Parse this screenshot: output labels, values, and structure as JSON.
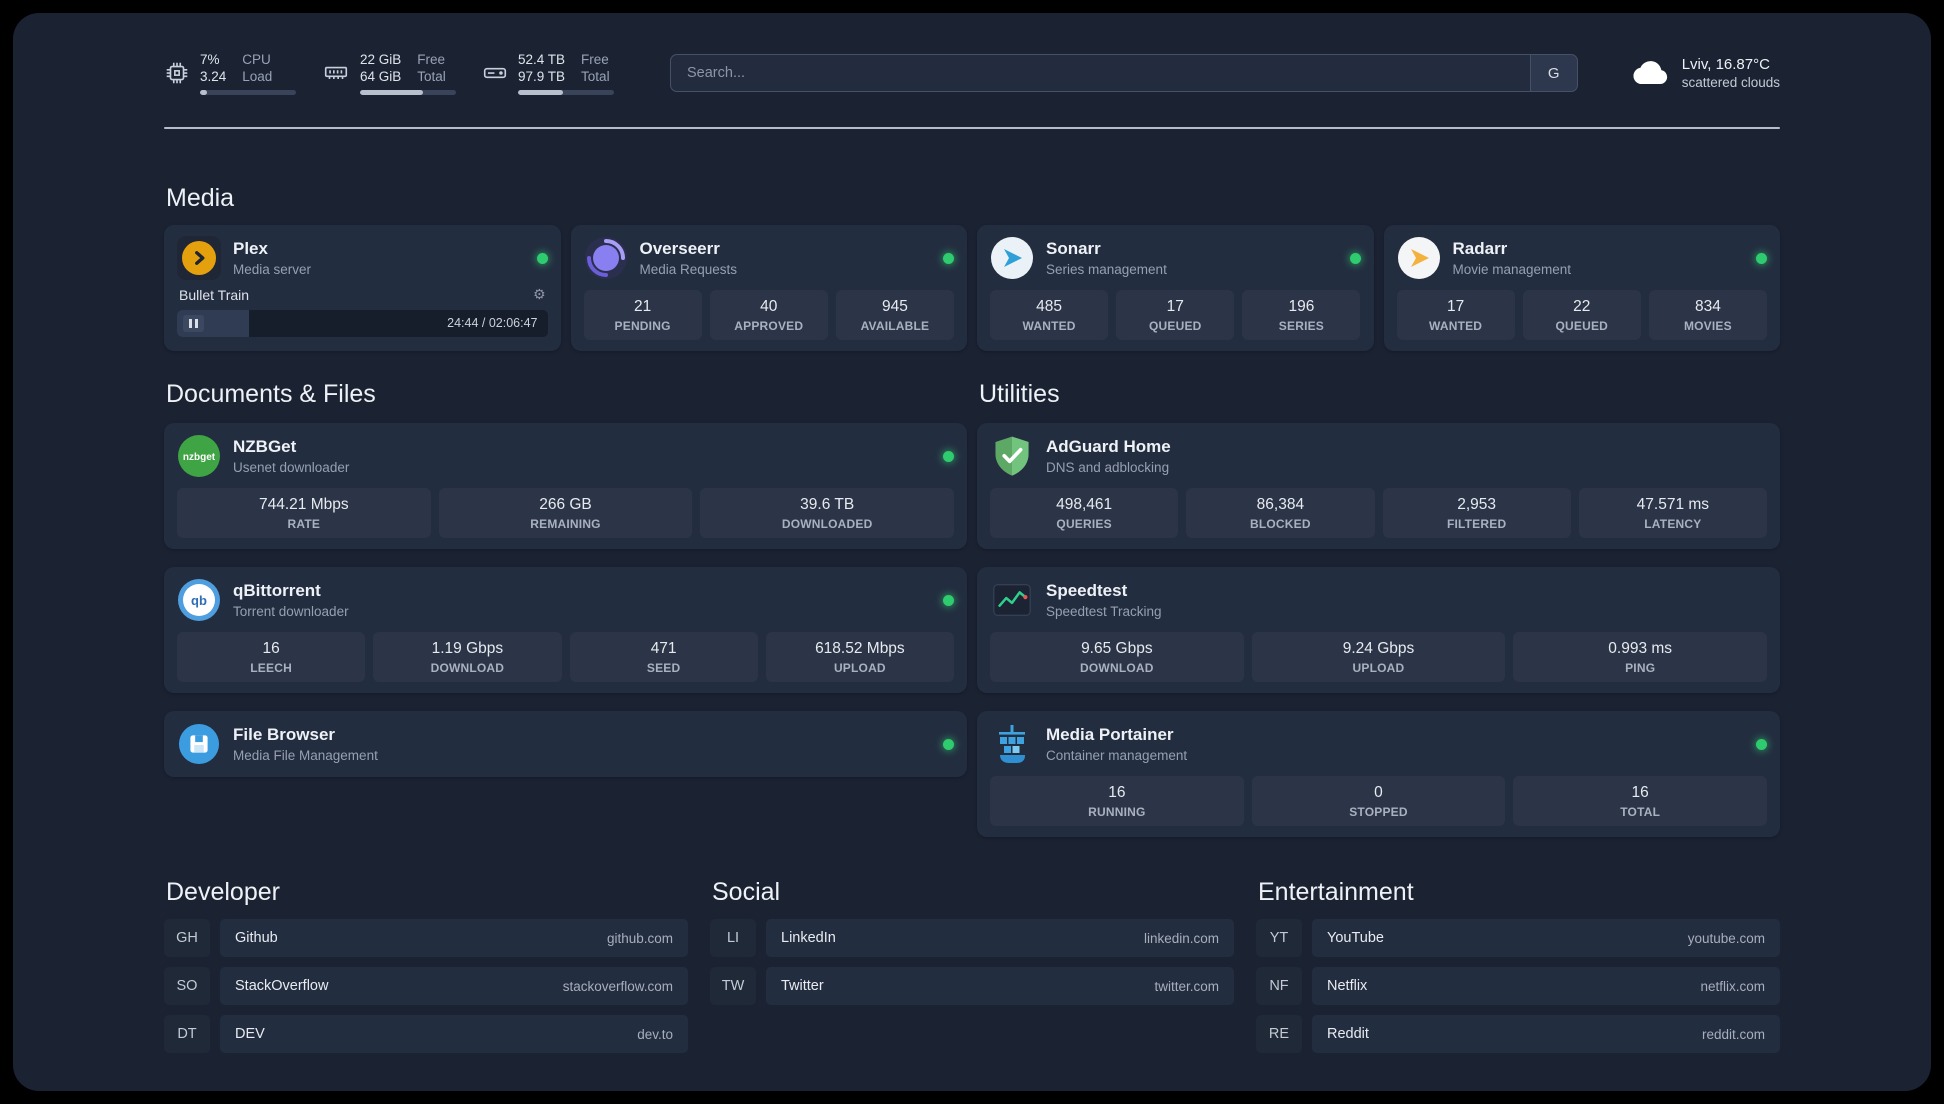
{
  "icons": {
    "gear": "⚙"
  },
  "topbar": {
    "cpu": {
      "value1": "7%",
      "value2": "3.24",
      "label1": "CPU",
      "label2": "Load",
      "progress_pct": 7
    },
    "memory": {
      "value1": "22 GiB",
      "value2": "64 GiB",
      "label1": "Free",
      "label2": "Total",
      "progress_pct": 66
    },
    "disk": {
      "value1": "52.4 TB",
      "value2": "97.9 TB",
      "label1": "Free",
      "label2": "Total",
      "progress_pct": 47
    },
    "search": {
      "placeholder": "Search...",
      "button_label": "G"
    },
    "weather": {
      "location": "Lviv, 16.87°C",
      "condition": "scattered clouds"
    }
  },
  "media": {
    "title": "Media",
    "plex": {
      "name": "Plex",
      "subtitle": "Media server",
      "now_playing": "Bullet Train",
      "time": "24:44 / 02:06:47",
      "progress_pct": 19.5
    },
    "overseerr": {
      "name": "Overseerr",
      "subtitle": "Media Requests",
      "stats": [
        {
          "value": "21",
          "label": "PENDING"
        },
        {
          "value": "40",
          "label": "APPROVED"
        },
        {
          "value": "945",
          "label": "AVAILABLE"
        }
      ]
    },
    "sonarr": {
      "name": "Sonarr",
      "subtitle": "Series management",
      "stats": [
        {
          "value": "485",
          "label": "WANTED"
        },
        {
          "value": "17",
          "label": "QUEUED"
        },
        {
          "value": "196",
          "label": "SERIES"
        }
      ]
    },
    "radarr": {
      "name": "Radarr",
      "subtitle": "Movie management",
      "stats": [
        {
          "value": "17",
          "label": "WANTED"
        },
        {
          "value": "22",
          "label": "QUEUED"
        },
        {
          "value": "834",
          "label": "MOVIES"
        }
      ]
    }
  },
  "documents": {
    "title": "Documents & Files",
    "nzbget": {
      "name": "NZBGet",
      "subtitle": "Usenet downloader",
      "icon_text": "nzbget",
      "stats": [
        {
          "value": "744.21 Mbps",
          "label": "RATE"
        },
        {
          "value": "266 GB",
          "label": "REMAINING"
        },
        {
          "value": "39.6 TB",
          "label": "DOWNLOADED"
        }
      ]
    },
    "qbittorrent": {
      "name": "qBittorrent",
      "subtitle": "Torrent downloader",
      "icon_text": "qb",
      "stats": [
        {
          "value": "16",
          "label": "LEECH"
        },
        {
          "value": "1.19 Gbps",
          "label": "DOWNLOAD"
        },
        {
          "value": "471",
          "label": "SEED"
        },
        {
          "value": "618.52 Mbps",
          "label": "UPLOAD"
        }
      ]
    },
    "filebrowser": {
      "name": "File Browser",
      "subtitle": "Media File Management"
    }
  },
  "utilities": {
    "title": "Utilities",
    "adguard": {
      "name": "AdGuard Home",
      "subtitle": "DNS and adblocking",
      "stats": [
        {
          "value": "498,461",
          "label": "QUERIES"
        },
        {
          "value": "86,384",
          "label": "BLOCKED"
        },
        {
          "value": "2,953",
          "label": "FILTERED"
        },
        {
          "value": "47.571 ms",
          "label": "LATENCY"
        }
      ]
    },
    "speedtest": {
      "name": "Speedtest",
      "subtitle": "Speedtest Tracking",
      "stats": [
        {
          "value": "9.65 Gbps",
          "label": "DOWNLOAD"
        },
        {
          "value": "9.24 Gbps",
          "label": "UPLOAD"
        },
        {
          "value": "0.993 ms",
          "label": "PING"
        }
      ]
    },
    "portainer": {
      "name": "Media Portainer",
      "subtitle": "Container management",
      "stats": [
        {
          "value": "16",
          "label": "RUNNING"
        },
        {
          "value": "0",
          "label": "STOPPED"
        },
        {
          "value": "16",
          "label": "TOTAL"
        }
      ]
    }
  },
  "bookmarks": {
    "developer": {
      "title": "Developer",
      "items": [
        {
          "abbr": "GH",
          "name": "Github",
          "url": "github.com"
        },
        {
          "abbr": "SO",
          "name": "StackOverflow",
          "url": "stackoverflow.com"
        },
        {
          "abbr": "DT",
          "name": "DEV",
          "url": "dev.to"
        }
      ]
    },
    "social": {
      "title": "Social",
      "items": [
        {
          "abbr": "LI",
          "name": "LinkedIn",
          "url": "linkedin.com"
        },
        {
          "abbr": "TW",
          "name": "Twitter",
          "url": "twitter.com"
        }
      ]
    },
    "entertainment": {
      "title": "Entertainment",
      "items": [
        {
          "abbr": "YT",
          "name": "YouTube",
          "url": "youtube.com"
        },
        {
          "abbr": "NF",
          "name": "Netflix",
          "url": "netflix.com"
        },
        {
          "abbr": "RE",
          "name": "Reddit",
          "url": "reddit.com"
        }
      ]
    }
  }
}
